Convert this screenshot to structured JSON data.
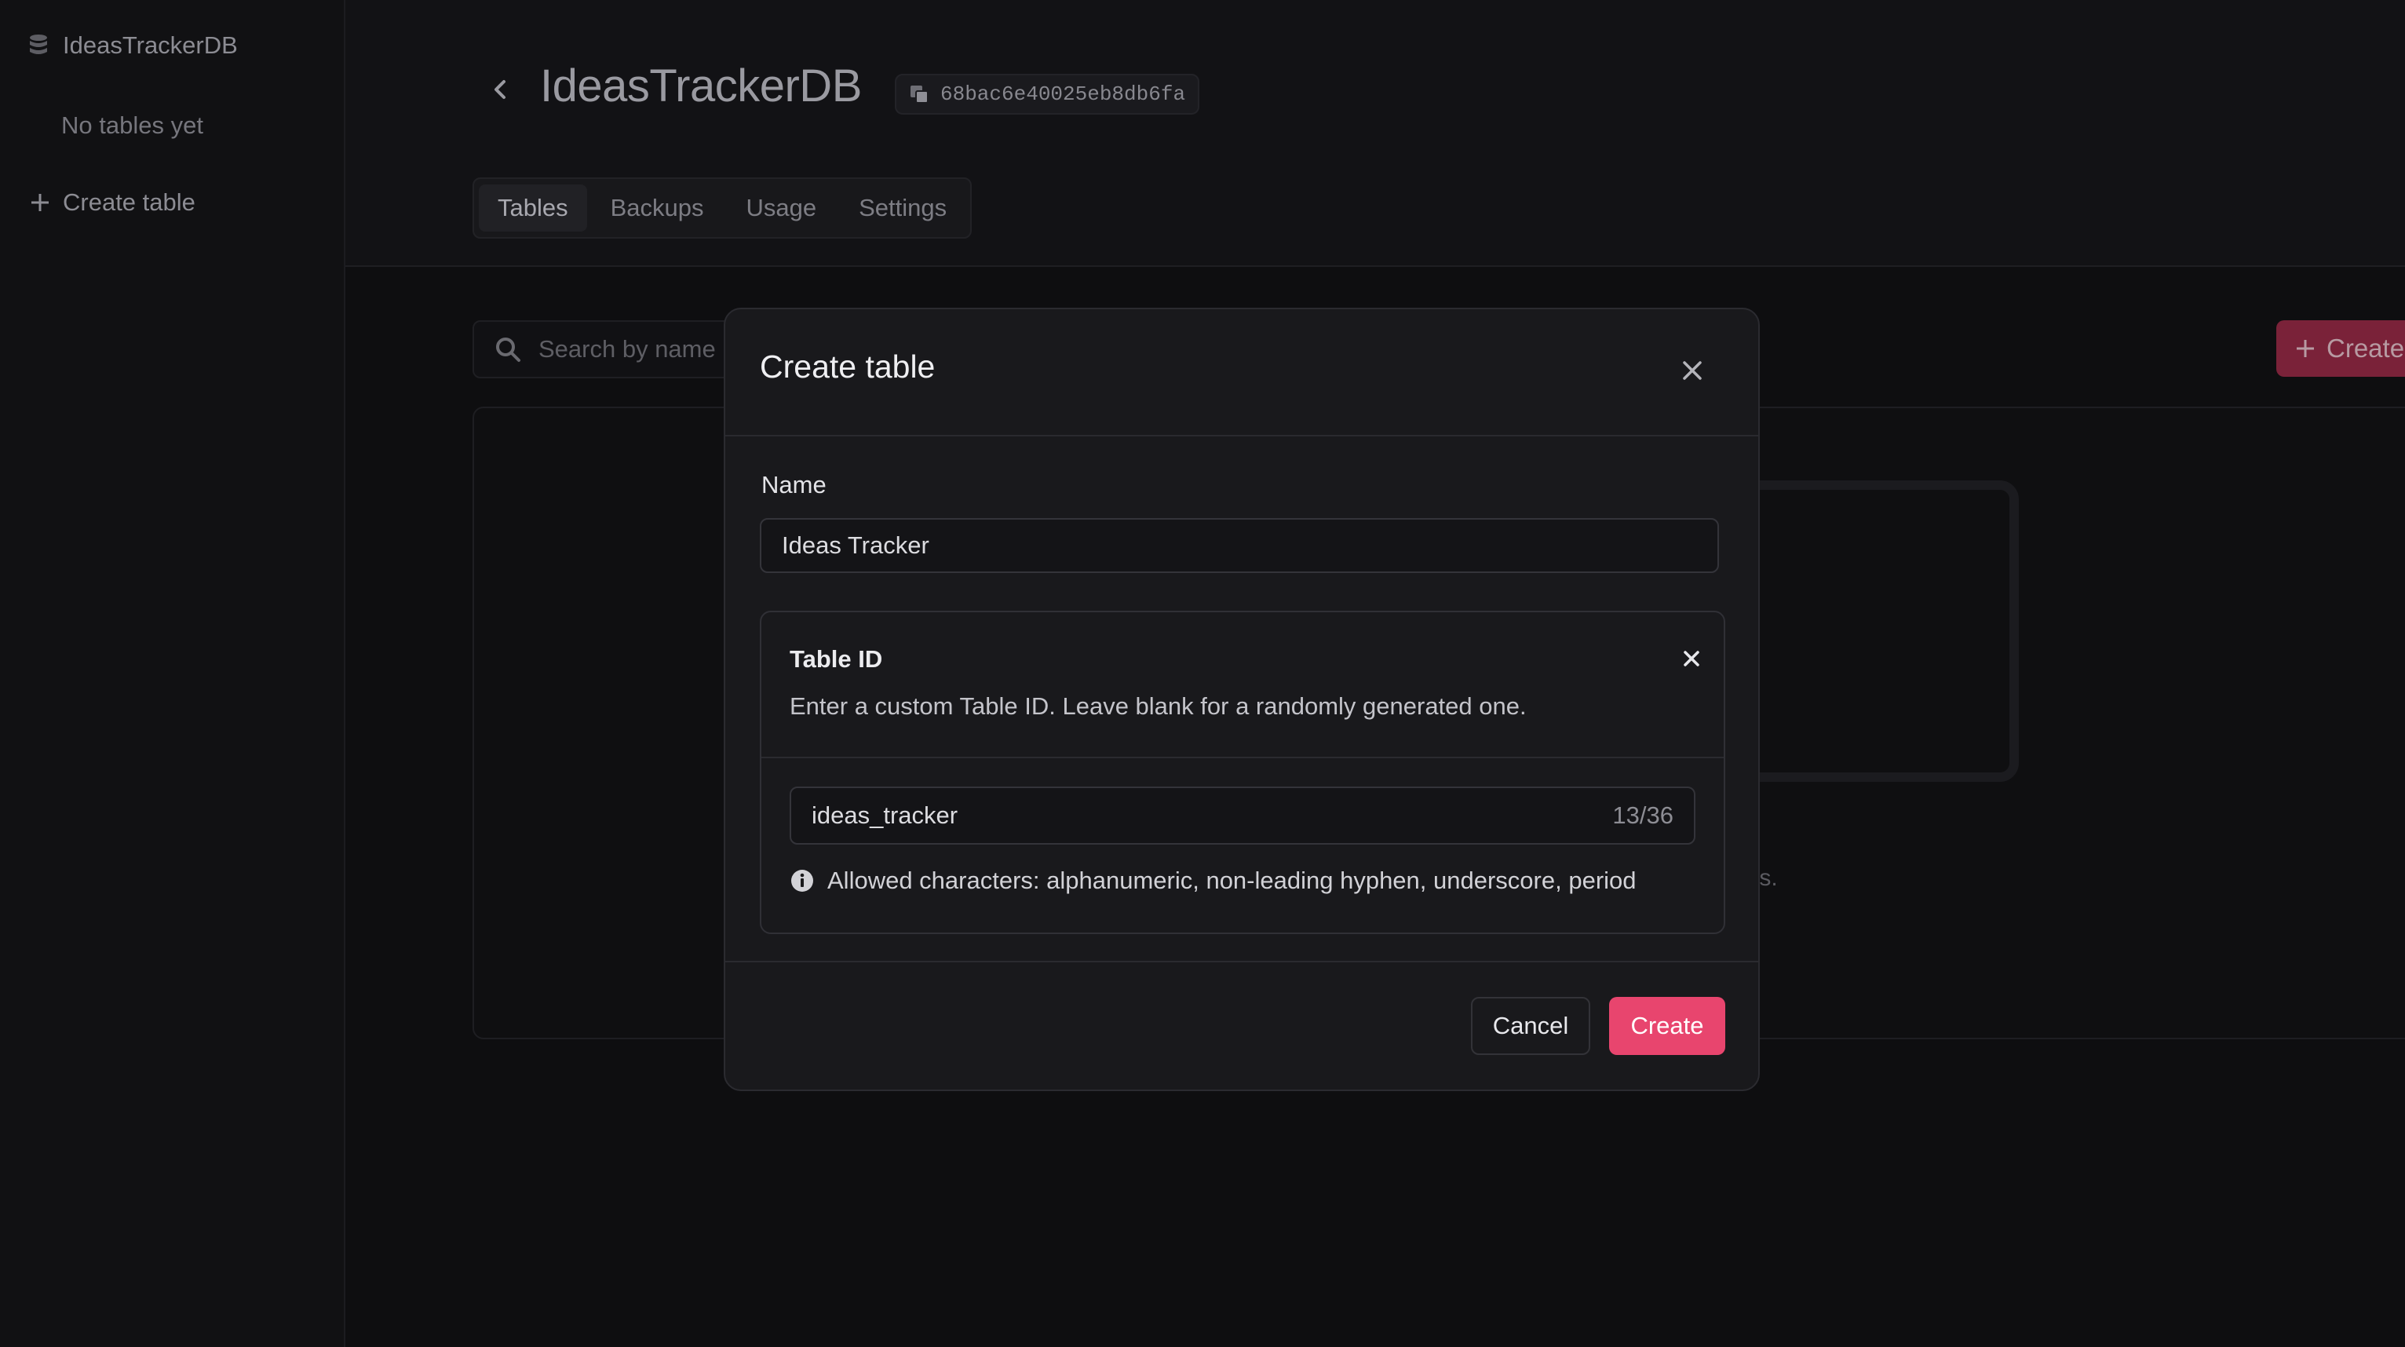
{
  "sidebar": {
    "database_name": "IdeasTrackerDB",
    "empty_label": "No tables yet",
    "create_table_label": "Create table"
  },
  "header": {
    "title": "IdeasTrackerDB",
    "database_id": "68bac6e40025eb8db6fa",
    "tabs": [
      {
        "label": "Tables",
        "active": true
      },
      {
        "label": "Backups",
        "active": false
      },
      {
        "label": "Usage",
        "active": false
      },
      {
        "label": "Settings",
        "active": false
      }
    ]
  },
  "toolbar": {
    "search_placeholder": "Search by name",
    "create_label": "Create"
  },
  "background_panel": {
    "partial_text": "les."
  },
  "modal": {
    "title": "Create table",
    "name_label": "Name",
    "name_value": "Ideas Tracker",
    "table_id": {
      "title": "Table ID",
      "description": "Enter a custom Table ID. Leave blank for a randomly generated one.",
      "value": "ideas_tracker",
      "counter": "13/36",
      "hint": "Allowed characters: alphanumeric, non-leading hyphen, underscore, period"
    },
    "cancel_label": "Cancel",
    "create_label": "Create"
  },
  "colors": {
    "accent": "#e8456e",
    "background": "#0e0e10",
    "modal_surface": "#19191c"
  },
  "icons": [
    "database-icon",
    "plus-icon",
    "chevron-left-icon",
    "copy-icon",
    "search-icon",
    "close-icon",
    "info-icon"
  ]
}
